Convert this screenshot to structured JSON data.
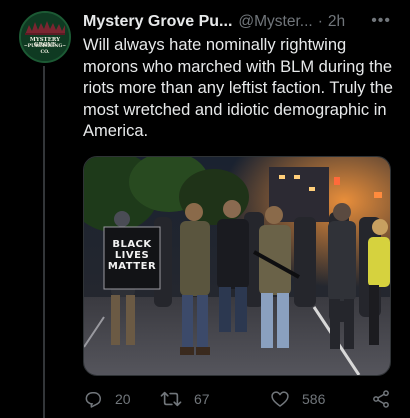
{
  "author": {
    "display_name": "Mystery Grove Pu...",
    "handle": "@Myster...",
    "separator": "·",
    "time": "2h",
    "avatar_lines": [
      "MYSTERY GROVE",
      "~PUBLISHING~",
      "CO."
    ]
  },
  "more_label": "•••",
  "tweet": {
    "text": "Will always hate nominally rightwing morons who marched with BLM during the riots more than any leftist faction. Truly the most wretched and idiotic demographic in America."
  },
  "media": {
    "sign_lines": [
      "BLACK",
      "LIVES",
      "MATTER"
    ]
  },
  "actions": {
    "reply_count": "20",
    "retweet_count": "67",
    "like_count": "586"
  },
  "colors": {
    "background": "#000000",
    "text_primary": "#e7e9ea",
    "text_secondary": "#71767b",
    "border": "#2f3336"
  },
  "icons": {
    "reply": "reply-icon",
    "retweet": "retweet-icon",
    "like": "heart-icon",
    "share": "share-icon",
    "more": "more-horizontal-icon"
  }
}
